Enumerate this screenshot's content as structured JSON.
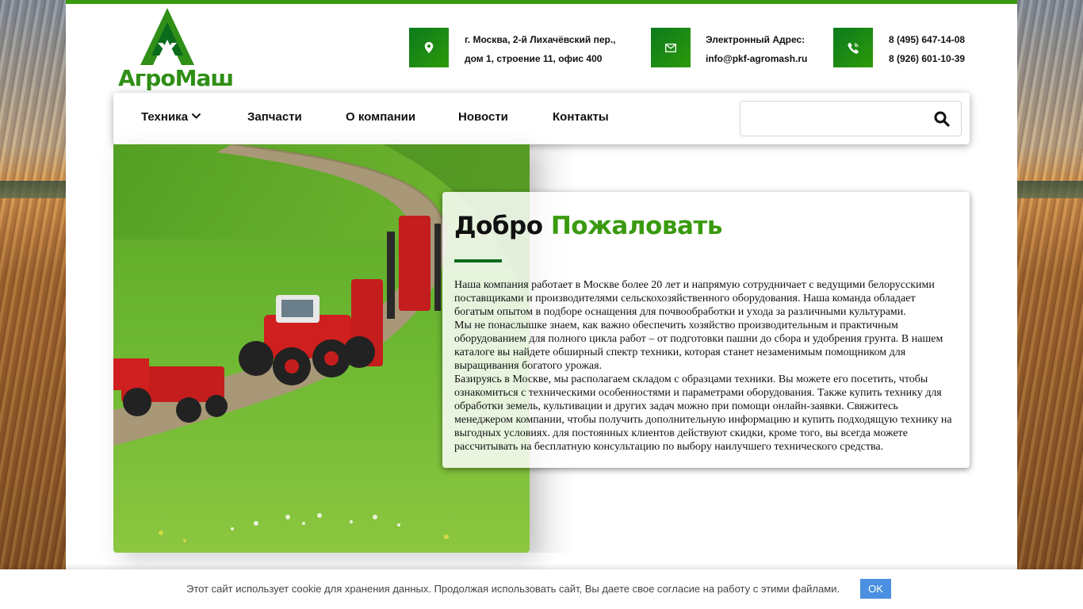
{
  "brand": {
    "name": "АгроМаш",
    "accent_color": "#3a9a0e",
    "dark_green": "#0b6b1c"
  },
  "contacts": {
    "address": {
      "icon": "location-pin-icon",
      "line1": "г. Москва, 2-й Лихачёвский пер.,",
      "line2": "дом 1, строение 11, офис 400"
    },
    "email": {
      "icon": "envelope-icon",
      "line1": "Электронный Адрес:",
      "line2": "info@pkf-agromash.ru"
    },
    "phone": {
      "icon": "phone-icon",
      "line1": "8 (495) 647-14-08",
      "line2": "8 (926) 601-10-39"
    }
  },
  "nav": {
    "items": [
      {
        "label": "Техника",
        "has_dropdown": true
      },
      {
        "label": "Запчасти"
      },
      {
        "label": "О компании"
      },
      {
        "label": "Новости"
      },
      {
        "label": "Контакты"
      }
    ],
    "search": {
      "value": "",
      "placeholder": "",
      "icon": "search-icon"
    }
  },
  "welcome": {
    "title_dark": "Добро",
    "title_accent": "Пожаловать",
    "paragraphs": [
      "Наша компания работает в Москве более 20 лет и напрямую сотрудничает с ведущими белорусскими поставщиками и производителями сельскохозяйственного оборудования. Наша команда обладает богатым опытом в подборе оснащения для почвообработки и ухода за различными культурами.",
      "Мы не понаслышке знаем, как важно обеспечить хозяйство производительным и практичным оборудованием для полного цикла работ – от подготовки пашни до сбора и удобрения грунта. В нашем каталоге вы найдете обширный спектр техники, которая станет незаменимым помощником для выращивания богатого урожая.",
      "Базируясь в Москве, мы располагаем складом с образцами техники. Вы можете его посетить, чтобы ознакомиться с техническими особенностями и параметрами оборудования. Также купить технику для обработки земель, культивации и других задач можно при помощи онлайн-заявки. Свяжитесь менеджером компании, чтобы получить дополнительную информацию и купить подходящую технику на выгодных условиях. для постоянных клиентов действуют скидки, кроме того, вы всегда можете рассчитывать на бесплатную консультацию по выбору наилучшего технического средства."
    ]
  },
  "cookie": {
    "message": "Этот сайт использует cookie для хранения данных. Продолжая использовать сайт, Вы даете свое согласие на работу с этими файлами.",
    "ok_label": "OK"
  }
}
